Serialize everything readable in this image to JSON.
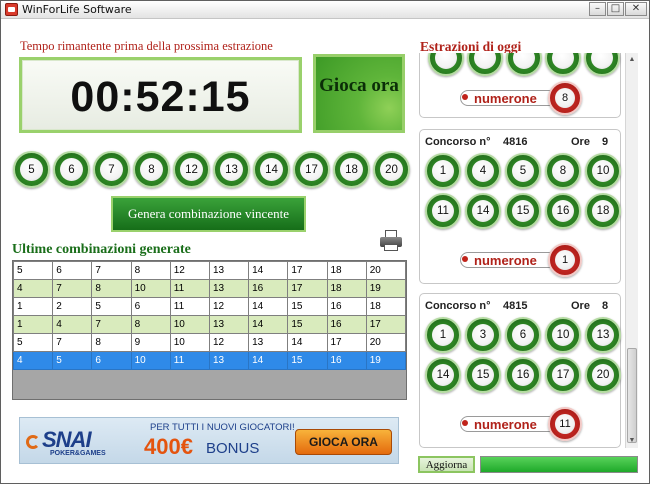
{
  "window": {
    "title": "WinForLife Software"
  },
  "timer": {
    "label": "Tempo rimantente prima della prossima estrazione",
    "value": "00:52:15"
  },
  "gioca_button": {
    "label": "Gioca ora"
  },
  "selected_numbers": [
    "5",
    "6",
    "7",
    "8",
    "12",
    "13",
    "14",
    "17",
    "18",
    "20"
  ],
  "genera_button": {
    "label": "Genera combinazione vincente"
  },
  "ultime": {
    "label": "Ultime combinazioni generate"
  },
  "combinations": {
    "rows": [
      {
        "style": "white",
        "cells": [
          "5",
          "6",
          "7",
          "8",
          "12",
          "13",
          "14",
          "17",
          "18",
          "20"
        ]
      },
      {
        "style": "green",
        "cells": [
          "4",
          "7",
          "8",
          "10",
          "11",
          "13",
          "16",
          "17",
          "18",
          "19"
        ]
      },
      {
        "style": "white",
        "cells": [
          "1",
          "2",
          "5",
          "6",
          "11",
          "12",
          "14",
          "15",
          "16",
          "18"
        ]
      },
      {
        "style": "green",
        "cells": [
          "1",
          "4",
          "7",
          "8",
          "10",
          "13",
          "14",
          "15",
          "16",
          "17"
        ]
      },
      {
        "style": "white",
        "cells": [
          "5",
          "7",
          "8",
          "9",
          "10",
          "12",
          "13",
          "14",
          "17",
          "20"
        ]
      },
      {
        "style": "sel",
        "cells": [
          "4",
          "5",
          "6",
          "10",
          "11",
          "13",
          "14",
          "15",
          "16",
          "19"
        ]
      }
    ]
  },
  "banner": {
    "brand": "SNAI",
    "sub": "POKER&GAMES",
    "promo": "PER TUTTI I NUOVI GIOCATORI!",
    "amount": "400€",
    "bonus": "BONUS",
    "button": "GIOCA ORA"
  },
  "estrazioni": {
    "title": "Estrazioni di oggi",
    "numerone_label": "numerone",
    "top_partial": {
      "numerone": "8"
    },
    "draws": [
      {
        "concorso_label": "Concorso n°",
        "concorso": "4816",
        "ore_label": "Ore",
        "ore": "9",
        "numbers": [
          "1",
          "4",
          "5",
          "8",
          "10",
          "11",
          "14",
          "15",
          "16",
          "18"
        ],
        "numerone": "1"
      },
      {
        "concorso_label": "Concorso n°",
        "concorso": "4815",
        "ore_label": "Ore",
        "ore": "8",
        "numbers": [
          "1",
          "3",
          "6",
          "10",
          "13",
          "14",
          "15",
          "16",
          "17",
          "20"
        ],
        "numerone": "11"
      }
    ]
  },
  "aggiorna": {
    "label": "Aggiorna"
  },
  "progress": {
    "value_percent": 100
  }
}
